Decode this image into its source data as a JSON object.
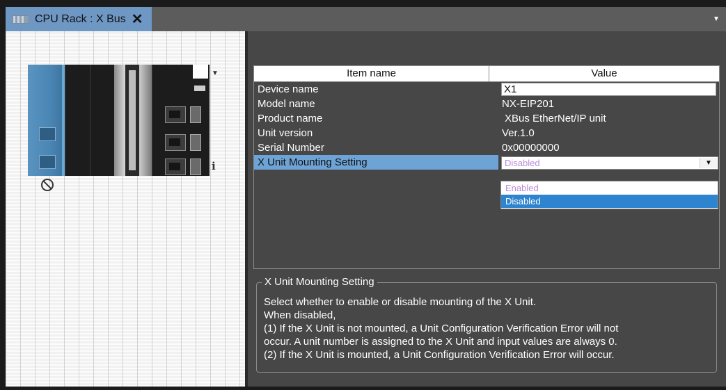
{
  "tab": {
    "title": "CPU Rack : X Bus",
    "close": "✕"
  },
  "table": {
    "header_item": "Item name",
    "header_value": "Value",
    "rows": [
      {
        "name": "Device name",
        "value": "X1"
      },
      {
        "name": "Model name",
        "value": "NX-EIP201"
      },
      {
        "name": "Product name",
        "value": "XBus EtherNet/IP unit"
      },
      {
        "name": "Unit version",
        "value": "Ver.1.0"
      },
      {
        "name": "Serial Number",
        "value": "0x00000000"
      },
      {
        "name": "X Unit Mounting Setting",
        "value": "Disabled"
      }
    ],
    "dropdown_options": [
      "Enabled",
      "Disabled"
    ],
    "dropdown_selected": "Disabled"
  },
  "description": {
    "title": "X Unit Mounting Setting",
    "lines": [
      "Select whether to enable or disable mounting of the X Unit.",
      "When disabled,",
      "(1) If the X Unit is not mounted, a Unit Configuration Verification Error will not",
      "occur. A unit number is assigned to the X Unit and input values are always 0.",
      "(2) If the X Unit is mounted, a Unit Configuration Verification Error will occur."
    ]
  },
  "rack": {
    "info_label": "i"
  },
  "colors": {
    "tab_active": "#6f97c4",
    "panel_bg": "#474747",
    "row_selected": "#6ea3d6",
    "dropdown_highlight": "#2f84cf",
    "enabled_text": "#b98bd8"
  },
  "icons": [
    "tab-device-icon",
    "close-icon",
    "chevron-down-icon",
    "disabled-icon",
    "info-icon"
  ]
}
